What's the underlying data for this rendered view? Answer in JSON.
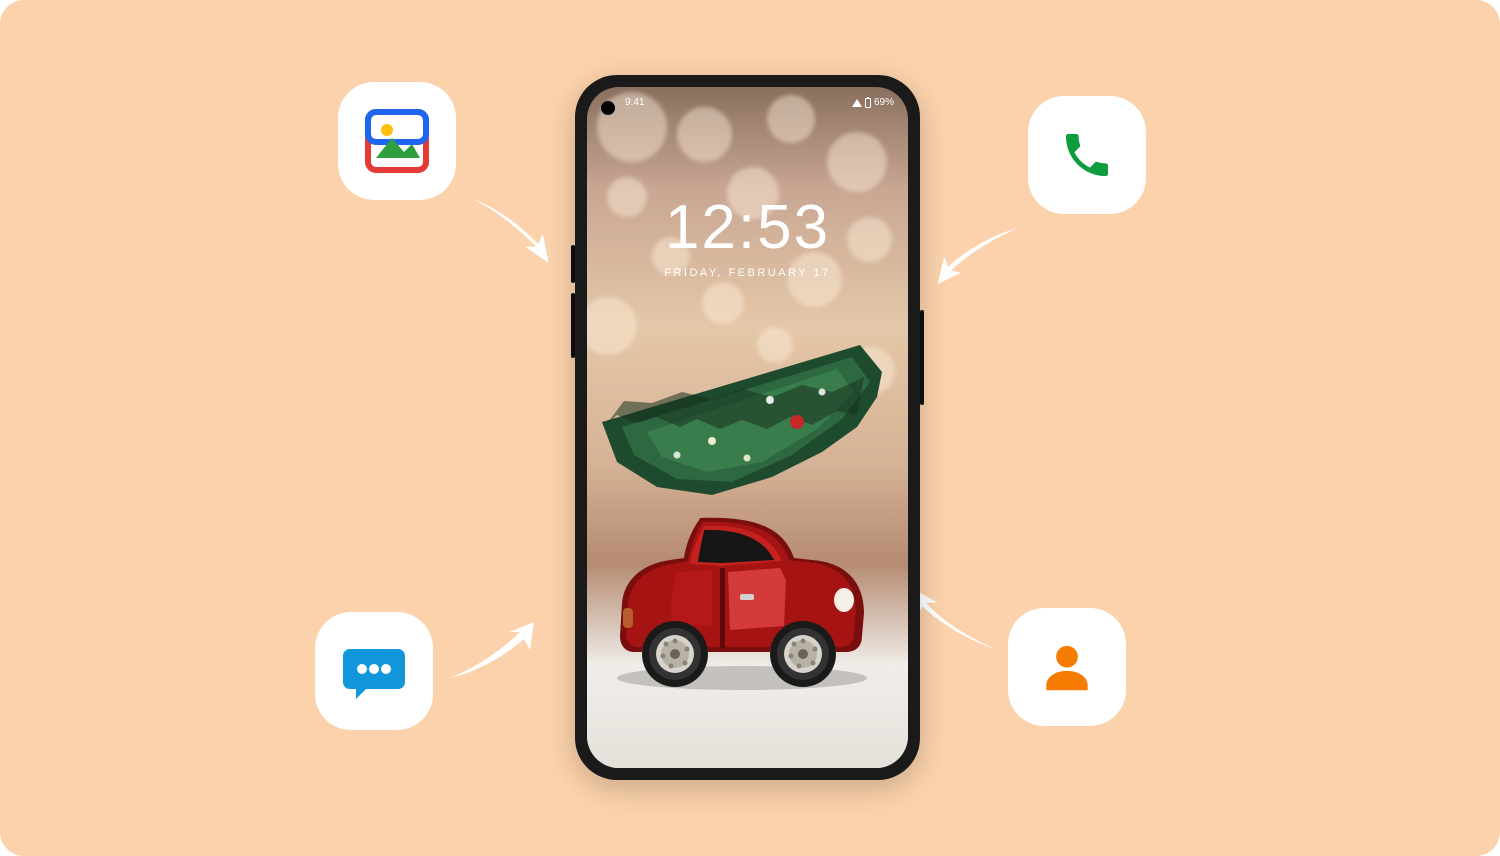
{
  "canvas": {
    "bg": "#fbd2ab"
  },
  "phone": {
    "status": {
      "time": "9:41",
      "battery_text": "69%"
    },
    "lock": {
      "time": "12:53",
      "date": "FRIDAY, FEBRUARY 17"
    }
  },
  "tiles": {
    "photos": "photos-app-icon",
    "phone": "phone-app-icon",
    "messages": "messages-app-icon",
    "contacts": "contacts-app-icon"
  }
}
